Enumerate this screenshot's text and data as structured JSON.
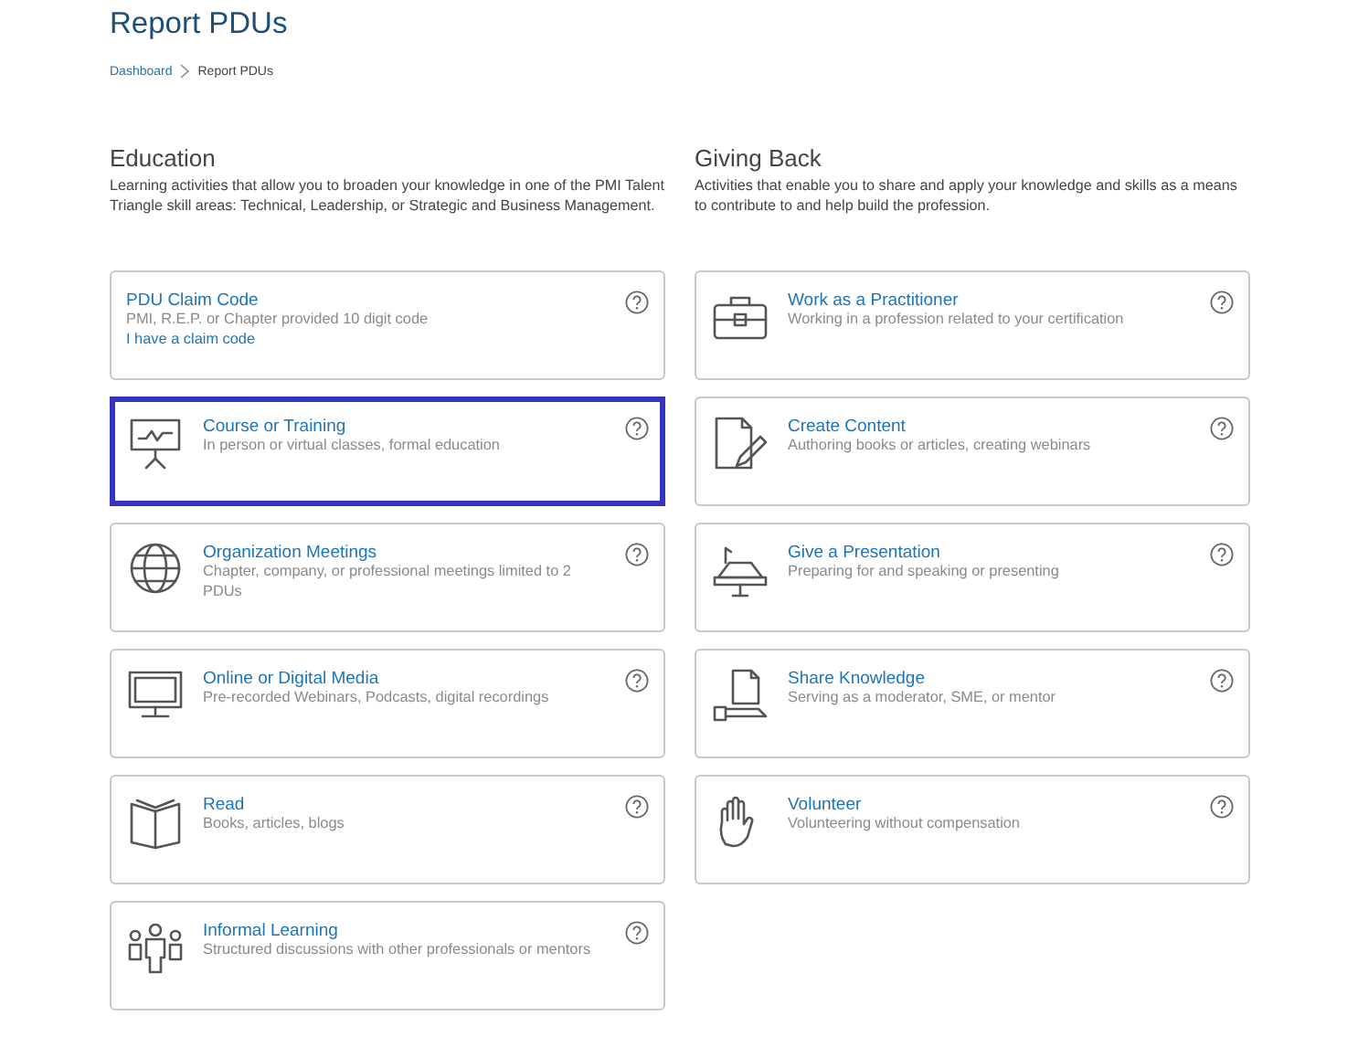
{
  "page": {
    "title": "Report PDUs"
  },
  "breadcrumb": [
    {
      "label": "Dashboard",
      "kind": "link"
    },
    {
      "label": "Report PDUs",
      "kind": "current"
    }
  ],
  "sections": [
    {
      "heading": "Education",
      "description": "Learning activities that allow you to broaden your knowledge in one of the PMI Talent Triangle skill areas: Technical, Leadership, or Strategic and Business Management.",
      "cards": [
        {
          "kind": "none",
          "title": "PDU Claim Code",
          "description": "PMI, R.E.P. or Chapter provided 10 digit code",
          "link": "I have a claim code",
          "selected": false
        },
        {
          "kind": "board",
          "title": "Course or Training",
          "description": "In person or virtual classes, formal education",
          "selected": true
        },
        {
          "kind": "globe",
          "title": "Organization Meetings",
          "description": "Chapter, company, or professional meetings limited to 2 PDUs",
          "selected": false
        },
        {
          "kind": "monitor",
          "title": "Online or Digital Media",
          "description": "Pre-recorded Webinars, Podcasts, digital recordings",
          "selected": false
        },
        {
          "kind": "book",
          "title": "Read",
          "description": "Books, articles, blogs",
          "selected": false
        },
        {
          "kind": "people",
          "title": "Informal Learning",
          "description": "Structured discussions with other professionals or mentors",
          "selected": false
        }
      ]
    },
    {
      "heading": "Giving Back",
      "description": "Activities that enable you to share and apply your knowledge and skills as a means to contribute to and help build the profession.",
      "cards": [
        {
          "kind": "briefcase",
          "title": "Work as a Practitioner",
          "description": "Working in a profession related to your certification",
          "selected": false
        },
        {
          "kind": "document",
          "title": "Create Content",
          "description": "Authoring books or articles, creating webinars",
          "selected": false
        },
        {
          "kind": "podium",
          "title": "Give a Presentation",
          "description": "Preparing for and speaking or presenting",
          "selected": false
        },
        {
          "kind": "share",
          "title": "Share Knowledge",
          "description": "Serving as a moderator, SME, or mentor",
          "selected": false
        },
        {
          "kind": "hand",
          "title": "Volunteer",
          "description": "Volunteering without compensation",
          "selected": false
        }
      ]
    }
  ]
}
